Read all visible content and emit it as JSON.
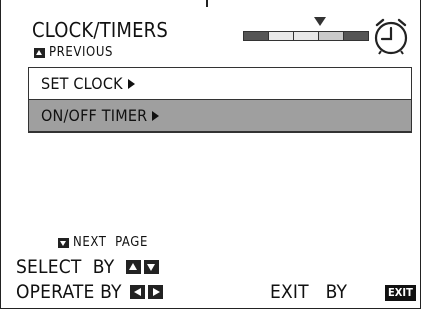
{
  "header": {
    "title": "CLOCK/TIMERS",
    "previous_label": "PREVIOUS",
    "clock_icon": "alarm-clock-icon"
  },
  "page_indicator": {
    "segments": 5,
    "current_segment": 4
  },
  "menu": {
    "items": [
      {
        "label": "SET CLOCK",
        "selected": false
      },
      {
        "label": "ON/OFF TIMER",
        "selected": true
      }
    ]
  },
  "footer": {
    "next_page_label": "NEXT  PAGE",
    "select_label": "SELECT  BY",
    "operate_label": "OPERATE BY",
    "exit_label": "EXIT   BY",
    "exit_key_label": "EXIT"
  }
}
